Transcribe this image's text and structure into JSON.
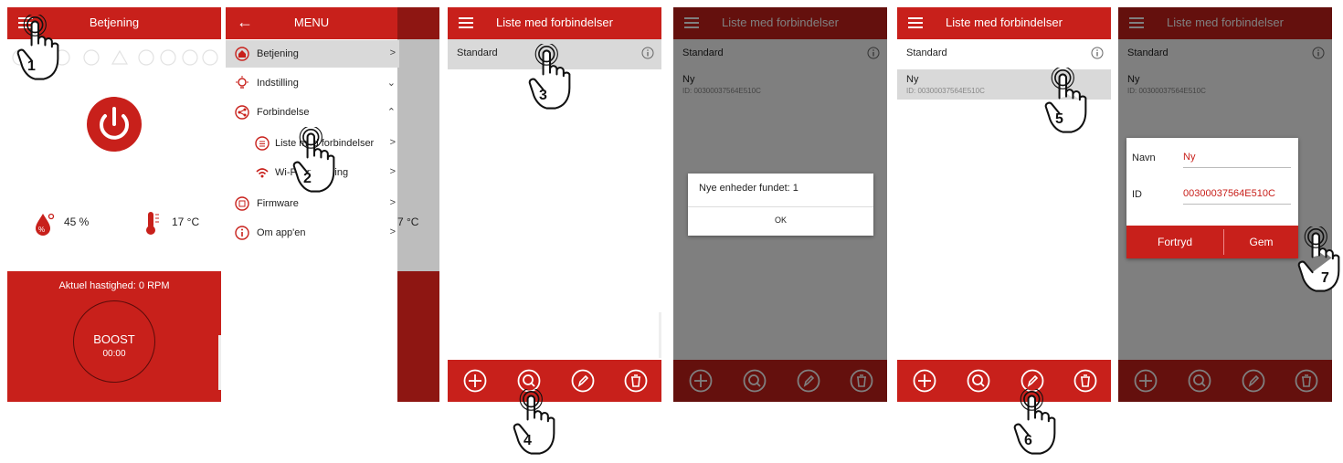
{
  "screen1": {
    "title": "Betjening",
    "humidity": "45 %",
    "temperature": "17 °C",
    "speed_text": "Aktuel hastighed: 0 RPM",
    "boost_label": "BOOST",
    "boost_time": "00:00"
  },
  "screen2": {
    "title": "MENU",
    "items": [
      {
        "label": "Betjening",
        "chevron": ">"
      },
      {
        "label": "Indstilling",
        "chevron": "v"
      },
      {
        "label": "Forbindelse",
        "chevron": "^"
      },
      {
        "label": "Liste med forbindelser",
        "chevron": ">"
      },
      {
        "label": "Wi-Fi opsætning",
        "chevron": ">"
      },
      {
        "label": "Firmware",
        "chevron": ">"
      },
      {
        "label": "Om app'en",
        "chevron": ">"
      }
    ],
    "peek_temp": "7 °C"
  },
  "screen3": {
    "title": "Liste med forbindelser",
    "row1": "Standard"
  },
  "screen4": {
    "title": "Liste med forbindelser",
    "row1": "Standard",
    "row2_name": "Ny",
    "row2_id": "ID: 00300037564E510C",
    "dialog_text": "Nye enheder fundet: 1",
    "dialog_ok": "OK"
  },
  "screen5": {
    "title": "Liste med forbindelser",
    "row1": "Standard",
    "row2_name": "Ny",
    "row2_id": "ID: 00300037564E510C"
  },
  "screen6": {
    "title": "Liste med forbindelser",
    "row1": "Standard",
    "row2_name": "Ny",
    "row2_id": "ID: 00300037564E510C",
    "name_label": "Navn",
    "name_value": "Ny",
    "id_label": "ID",
    "id_value": "00300037564E510C",
    "cancel": "Fortryd",
    "save": "Gem"
  },
  "steps": [
    "1",
    "2",
    "3",
    "4",
    "5",
    "6",
    "7"
  ],
  "colors": {
    "accent": "#c8201b",
    "selected_row": "#d9d9d9",
    "overlay": "#6e6e6e"
  }
}
